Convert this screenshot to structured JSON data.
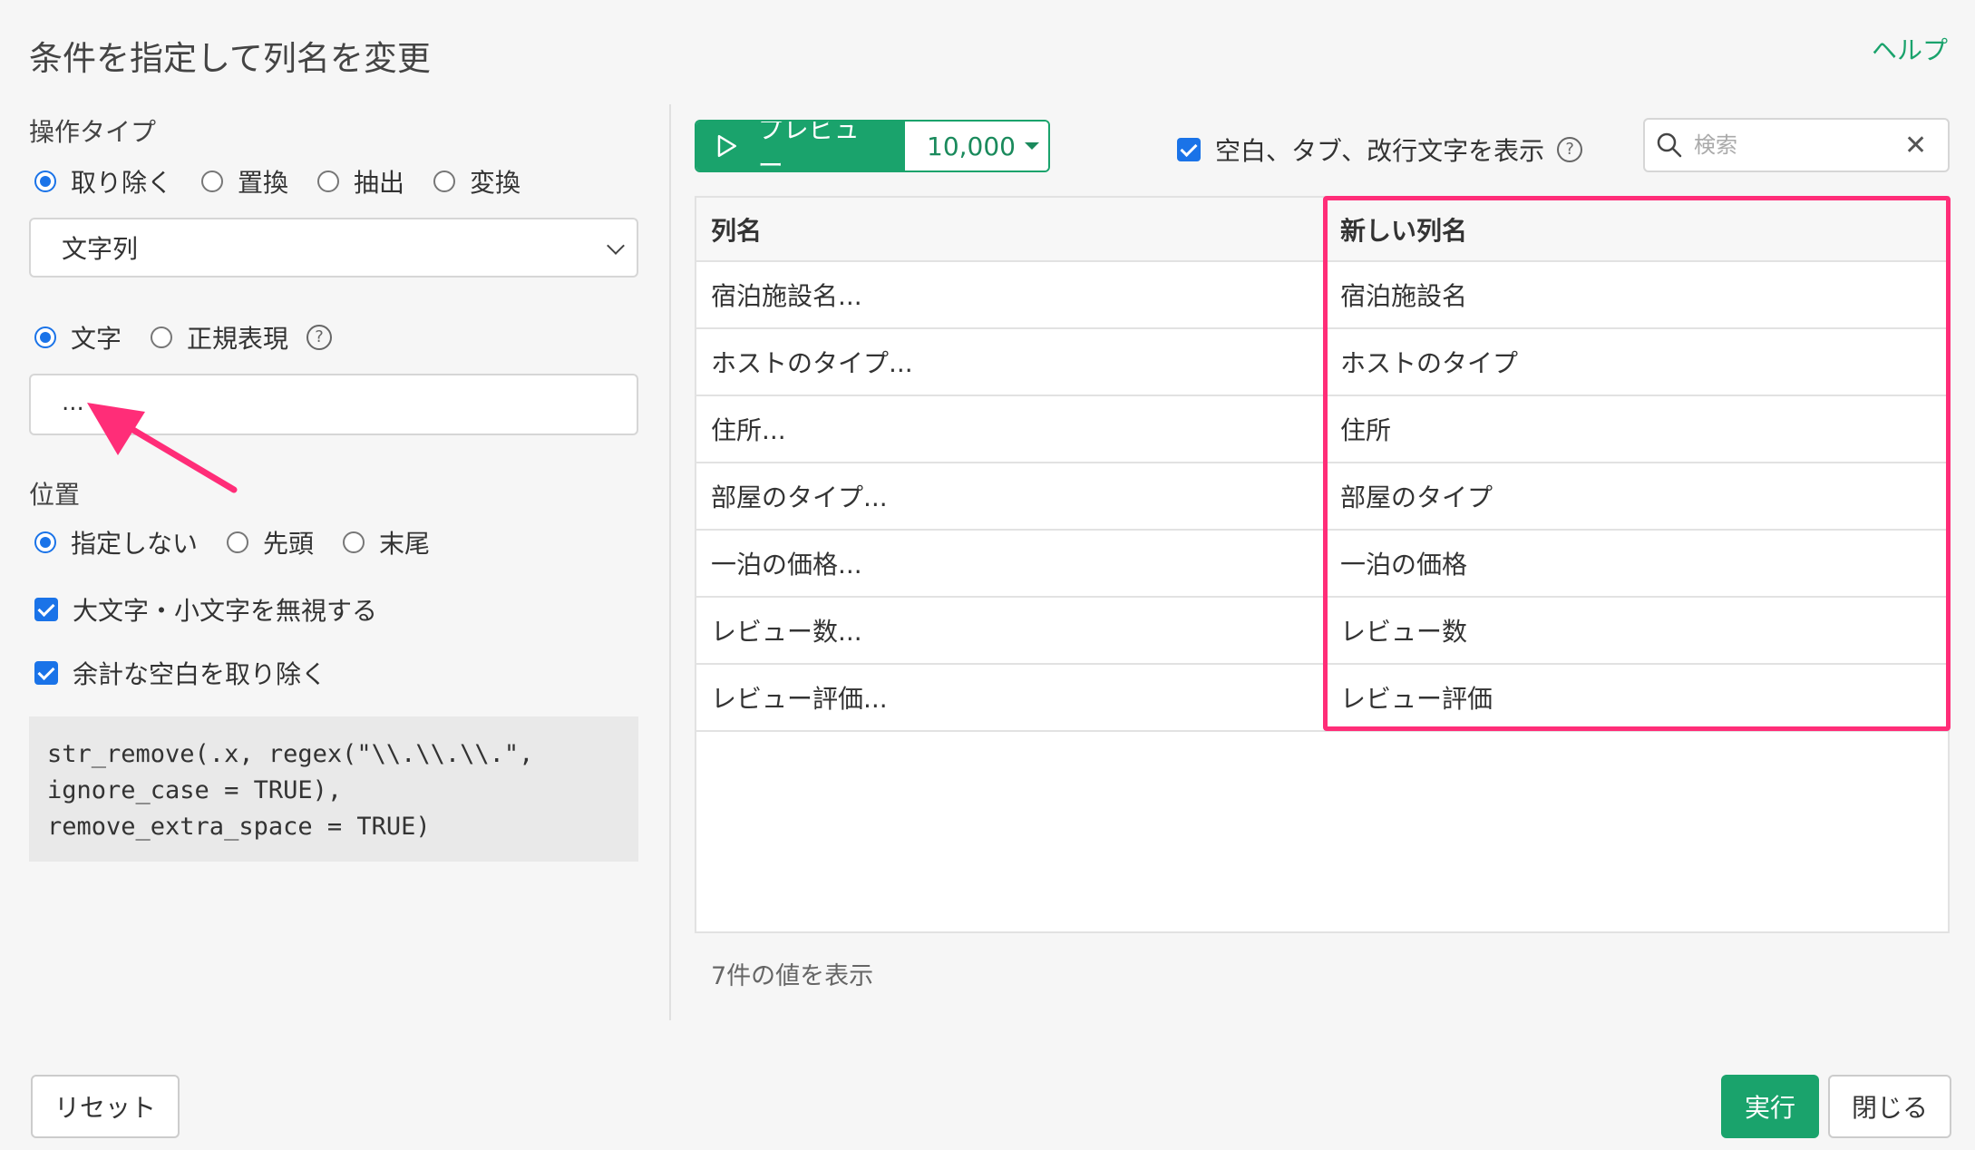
{
  "dialog": {
    "title": "条件を指定して列名を変更",
    "help_link": "ヘルプ"
  },
  "left": {
    "operation_type_label": "操作タイプ",
    "operation_types": [
      {
        "label": "取り除く",
        "selected": true
      },
      {
        "label": "置換",
        "selected": false
      },
      {
        "label": "抽出",
        "selected": false
      },
      {
        "label": "変換",
        "selected": false
      }
    ],
    "target_select": {
      "value": "文字列"
    },
    "match_modes": [
      {
        "label": "文字",
        "selected": true
      },
      {
        "label": "正規表現",
        "selected": false
      }
    ],
    "help_icon_glyph": "?",
    "pattern_input": {
      "value": "..."
    },
    "position_label": "位置",
    "positions": [
      {
        "label": "指定しない",
        "selected": true
      },
      {
        "label": "先頭",
        "selected": false
      },
      {
        "label": "末尾",
        "selected": false
      }
    ],
    "ignore_case": {
      "label": "大文字・小文字を無視する",
      "checked": true
    },
    "remove_extra_space": {
      "label": "余計な空白を取り除く",
      "checked": true
    },
    "code": "str_remove(.x, regex(\"\\\\.\\\\.\\\\.\",\nignore_case = TRUE),\nremove_extra_space = TRUE)"
  },
  "toolbar": {
    "preview_label": "プレビュー",
    "rows_value": "10,000",
    "show_whitespace": {
      "label": "空白、タブ、改行文字を表示",
      "checked": true
    },
    "search_placeholder": "検索",
    "clear_glyph": "✕"
  },
  "table": {
    "headers": [
      "列名",
      "新しい列名"
    ],
    "rows": [
      [
        "宿泊施設名...",
        "宿泊施設名"
      ],
      [
        "ホストのタイプ...",
        "ホストのタイプ"
      ],
      [
        "住所...",
        "住所"
      ],
      [
        "部屋のタイプ...",
        "部屋のタイプ"
      ],
      [
        "一泊の価格...",
        "一泊の価格"
      ],
      [
        "レビュー数...",
        "レビュー数"
      ],
      [
        "レビュー評価...",
        "レビュー評価"
      ]
    ],
    "count_label": "7件の値を表示"
  },
  "footer": {
    "reset_label": "リセット",
    "run_label": "実行",
    "close_label": "閉じる"
  },
  "colors": {
    "accent_green": "#1aa36c",
    "radio_blue": "#1a73e8",
    "highlight_pink": "#ff2d78"
  },
  "icons": {
    "play": "play-icon",
    "search": "search-icon",
    "clear": "close-icon",
    "help": "question-circle-icon",
    "chevron": "chevron-down-icon",
    "arrow": "annotation-arrow-icon"
  }
}
